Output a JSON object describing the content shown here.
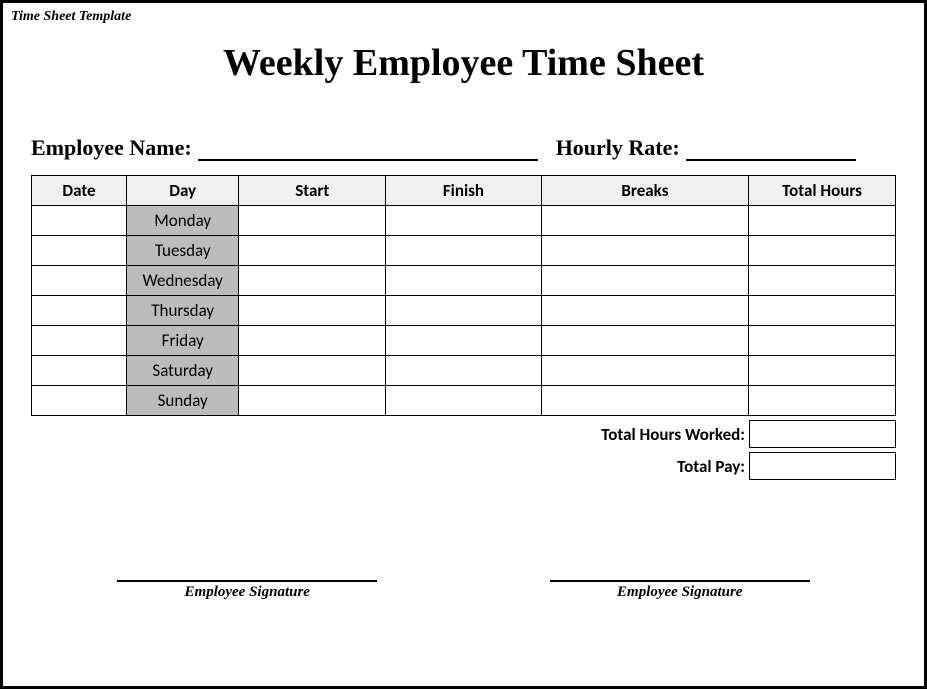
{
  "template_tag": "Time Sheet Template",
  "title": "Weekly Employee Time Sheet",
  "fields": {
    "employee_name_label": "Employee Name:",
    "hourly_rate_label": "Hourly Rate:"
  },
  "table": {
    "headers": {
      "date": "Date",
      "day": "Day",
      "start": "Start",
      "finish": "Finish",
      "breaks": "Breaks",
      "total_hours": "Total Hours"
    },
    "days": [
      "Monday",
      "Tuesday",
      "Wednesday",
      "Thursday",
      "Friday",
      "Saturday",
      "Sunday"
    ]
  },
  "summary": {
    "total_hours_worked_label": "Total Hours Worked:",
    "total_pay_label": "Total Pay:"
  },
  "signatures": {
    "left_label": "Employee Signature",
    "right_label": "Employee Signature"
  }
}
